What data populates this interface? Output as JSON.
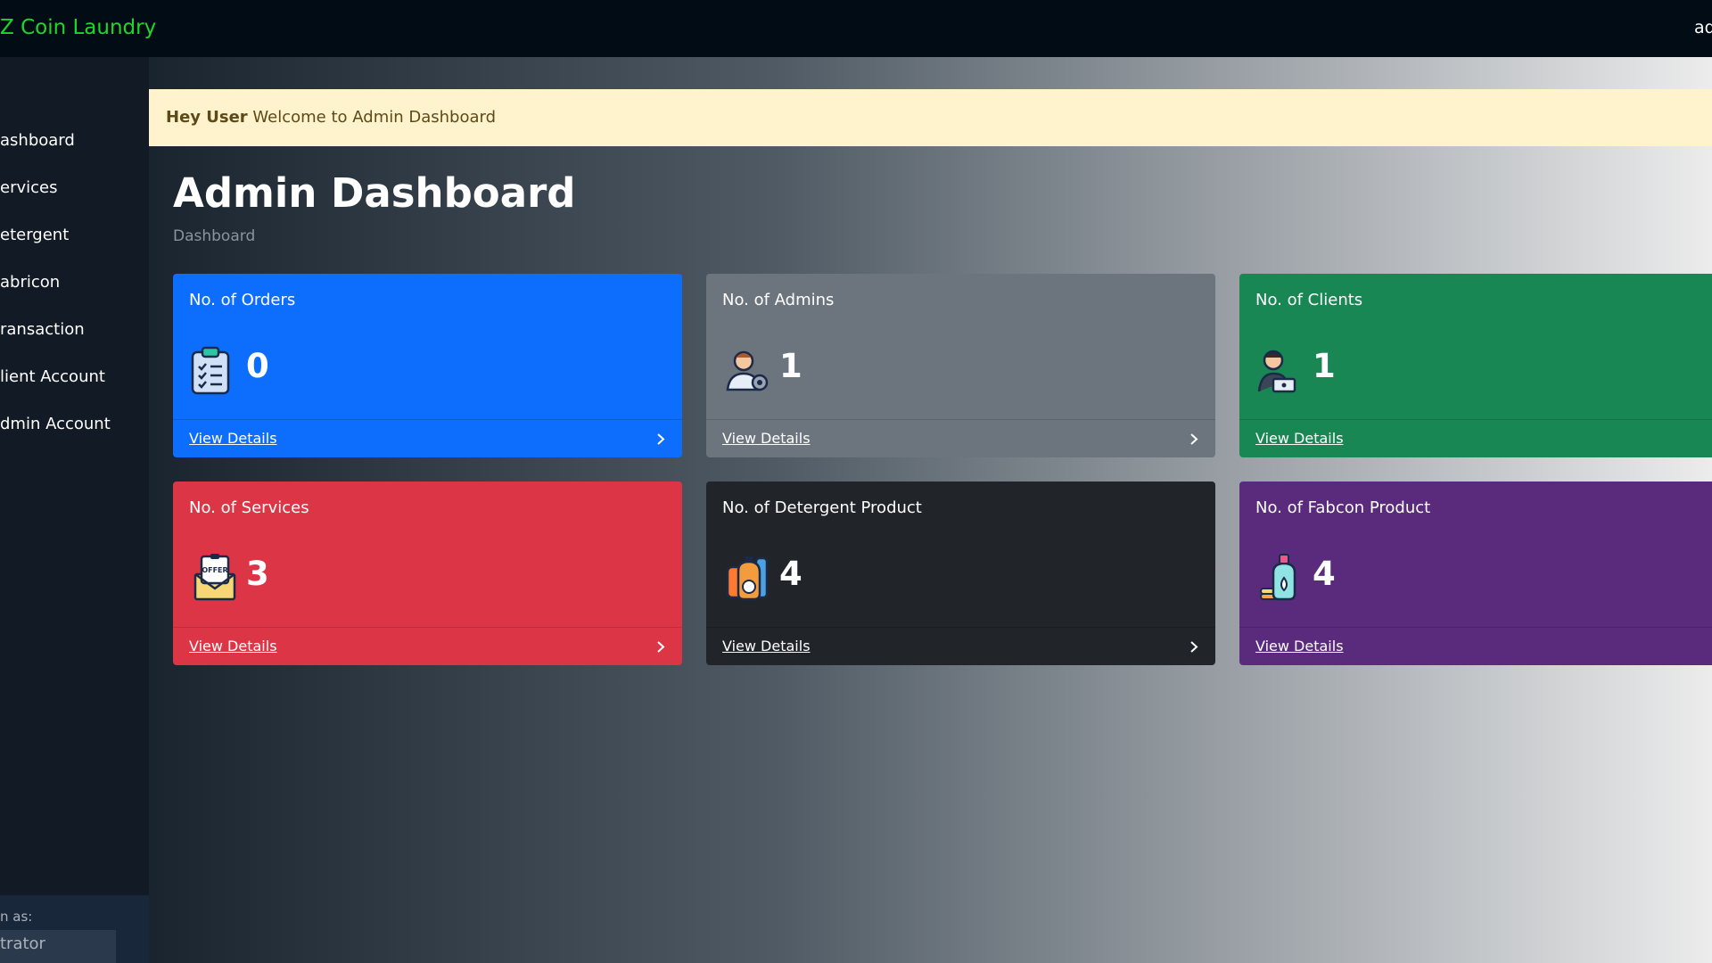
{
  "header": {
    "brand": "Z Coin Laundry",
    "user_label": "ad"
  },
  "sidebar": {
    "items": [
      {
        "label": "ashboard"
      },
      {
        "label": "ervices"
      },
      {
        "label": "etergent"
      },
      {
        "label": "abricon"
      },
      {
        "label": "ransaction"
      },
      {
        "label": "lient Account"
      },
      {
        "label": "dmin Account"
      }
    ],
    "footer_label": "n as:",
    "footer_role": "trator"
  },
  "alert": {
    "bold": "Hey User",
    "text": "Welcome to Admin Dashboard"
  },
  "page": {
    "title": "Admin Dashboard",
    "breadcrumb": "Dashboard"
  },
  "cards": [
    {
      "title": "No. of Orders",
      "value": "0",
      "link": "View Details",
      "icon": "clipboard-list-icon",
      "color": "#0d6efd"
    },
    {
      "title": "No. of Admins",
      "value": "1",
      "link": "View Details",
      "icon": "admin-user-gear-icon",
      "color": "#6c757d"
    },
    {
      "title": "No. of Clients",
      "value": "1",
      "link": "View Details",
      "icon": "client-user-laptop-icon",
      "color": "#198754"
    },
    {
      "title": "No. of Services",
      "value": "3",
      "link": "View Details",
      "icon": "offer-envelope-icon",
      "color": "#dc3545"
    },
    {
      "title": "No. of Detergent Product",
      "value": "4",
      "link": "View Details",
      "icon": "detergent-bottles-icon",
      "color": "#212529"
    },
    {
      "title": "No. of Fabcon Product",
      "value": "4",
      "link": "View Details",
      "icon": "fabcon-bottle-icon",
      "color": "#5a2a7d"
    }
  ]
}
